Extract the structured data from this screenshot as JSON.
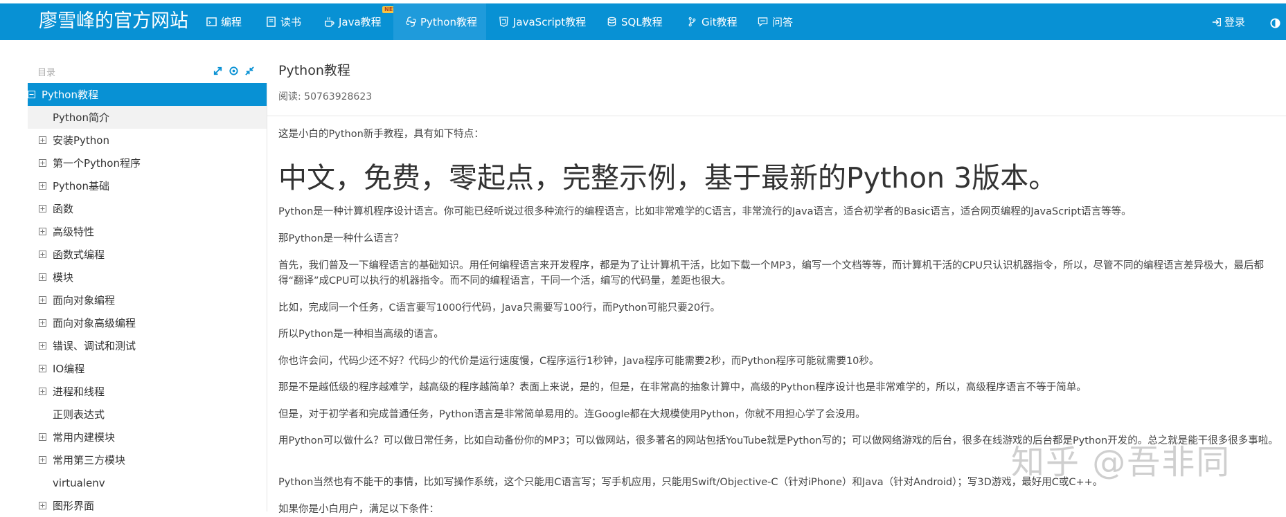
{
  "navbar": {
    "brand": "廖雪峰的官方网站",
    "items": [
      {
        "label": "编程",
        "icon": "code-icon"
      },
      {
        "label": "读书",
        "icon": "book-icon"
      },
      {
        "label": "Java教程",
        "icon": "coffee-cup-icon",
        "badge": "NEW"
      },
      {
        "label": "Python教程",
        "icon": "python-icon",
        "active": true
      },
      {
        "label": "JavaScript教程",
        "icon": "html5-icon"
      },
      {
        "label": "SQL教程",
        "icon": "database-icon"
      },
      {
        "label": "Git教程",
        "icon": "git-branch-icon"
      },
      {
        "label": "问答",
        "icon": "comment-icon"
      }
    ],
    "login_label": "登录",
    "colors": {
      "bar": "#0891d4",
      "active": "#1f9bdb"
    }
  },
  "sidebar": {
    "title": "目录",
    "tools": [
      "expand-icon",
      "target-icon",
      "collapse-icon"
    ],
    "items": [
      {
        "label": "Python教程",
        "toggle": "minus"
      },
      {
        "label": "Python简介",
        "toggle": "none"
      },
      {
        "label": "安装Python",
        "toggle": "plus"
      },
      {
        "label": "第一个Python程序",
        "toggle": "plus"
      },
      {
        "label": "Python基础",
        "toggle": "plus"
      },
      {
        "label": "函数",
        "toggle": "plus"
      },
      {
        "label": "高级特性",
        "toggle": "plus"
      },
      {
        "label": "函数式编程",
        "toggle": "plus"
      },
      {
        "label": "模块",
        "toggle": "plus"
      },
      {
        "label": "面向对象编程",
        "toggle": "plus"
      },
      {
        "label": "面向对象高级编程",
        "toggle": "plus"
      },
      {
        "label": "错误、调试和测试",
        "toggle": "plus"
      },
      {
        "label": "IO编程",
        "toggle": "plus"
      },
      {
        "label": "进程和线程",
        "toggle": "plus"
      },
      {
        "label": "正则表达式",
        "toggle": "none"
      },
      {
        "label": "常用内建模块",
        "toggle": "plus"
      },
      {
        "label": "常用第三方模块",
        "toggle": "plus"
      },
      {
        "label": "virtualenv",
        "toggle": "none"
      },
      {
        "label": "图形界面",
        "toggle": "plus"
      }
    ]
  },
  "content": {
    "title": "Python教程",
    "read_count": "阅读: 50763928623",
    "intro": "这是小白的Python新手教程，具有如下特点：",
    "headline": "中文，免费，零起点，完整示例，基于最新的Python 3版本。",
    "paragraphs": [
      "Python是一种计算机程序设计语言。你可能已经听说过很多种流行的编程语言，比如非常难学的C语言，非常流行的Java语言，适合初学者的Basic语言，适合网页编程的JavaScript语言等等。",
      "那Python是一种什么语言？",
      "首先，我们普及一下编程语言的基础知识。用任何编程语言来开发程序，都是为了让计算机干活，比如下载一个MP3，编写一个文档等等，而计算机干活的CPU只认识机器指令，所以，尽管不同的编程语言差异极大，最后都得“翻译”成CPU可以执行的机器指令。而不同的编程语言，干同一个活，编写的代码量，差距也很大。",
      "比如，完成同一个任务，C语言要写1000行代码，Java只需要写100行，而Python可能只要20行。",
      "所以Python是一种相当高级的语言。",
      "你也许会问，代码少还不好？代码少的代价是运行速度慢，C程序运行1秒钟，Java程序可能需要2秒，而Python程序可能就需要10秒。",
      "那是不是越低级的程序越难学，越高级的程序越简单？表面上来说，是的，但是，在非常高的抽象计算中，高级的Python程序设计也是非常难学的，所以，高级程序语言不等于简单。",
      "但是，对于初学者和完成普通任务，Python语言是非常简单易用的。连Google都在大规模使用Python，你就不用担心学了会没用。",
      "用Python可以做什么？可以做日常任务，比如自动备份你的MP3；可以做网站，很多著名的网站包括YouTube就是Python写的；可以做网络游戏的后台，很多在线游戏的后台都是Python开发的。总之就是能干很多很多事啦。",
      "Python当然也有不能干的事情，比如写操作系统，这个只能用C语言写；写手机应用，只能用Swift/Objective-C（针对iPhone）和Java（针对Android）；写3D游戏，最好用C或C++。",
      "如果你是小白用户，满足以下条件："
    ]
  },
  "watermark": "知乎 @吾非同"
}
